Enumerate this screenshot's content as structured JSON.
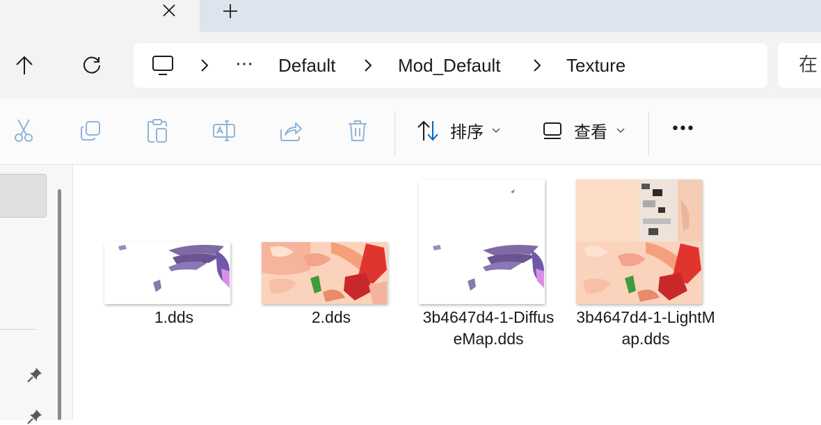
{
  "breadcrumb": {
    "overflow": "⋯",
    "items": [
      "Default",
      "Mod_Default",
      "Texture"
    ]
  },
  "search": {
    "placeholder": "在"
  },
  "commandbar": {
    "sort_label": "排序",
    "view_label": "查看",
    "more_label": "•••"
  },
  "files": [
    {
      "name": "1.dds"
    },
    {
      "name": "2.dds"
    },
    {
      "name": "3b4647d4-1-DiffuseMap.dds"
    },
    {
      "name": "3b4647d4-1-LightMap.dds"
    }
  ],
  "colors": {
    "accent": "#0067c0",
    "tabstrip": "#dde4ee",
    "chrome": "#f3f3f3"
  }
}
